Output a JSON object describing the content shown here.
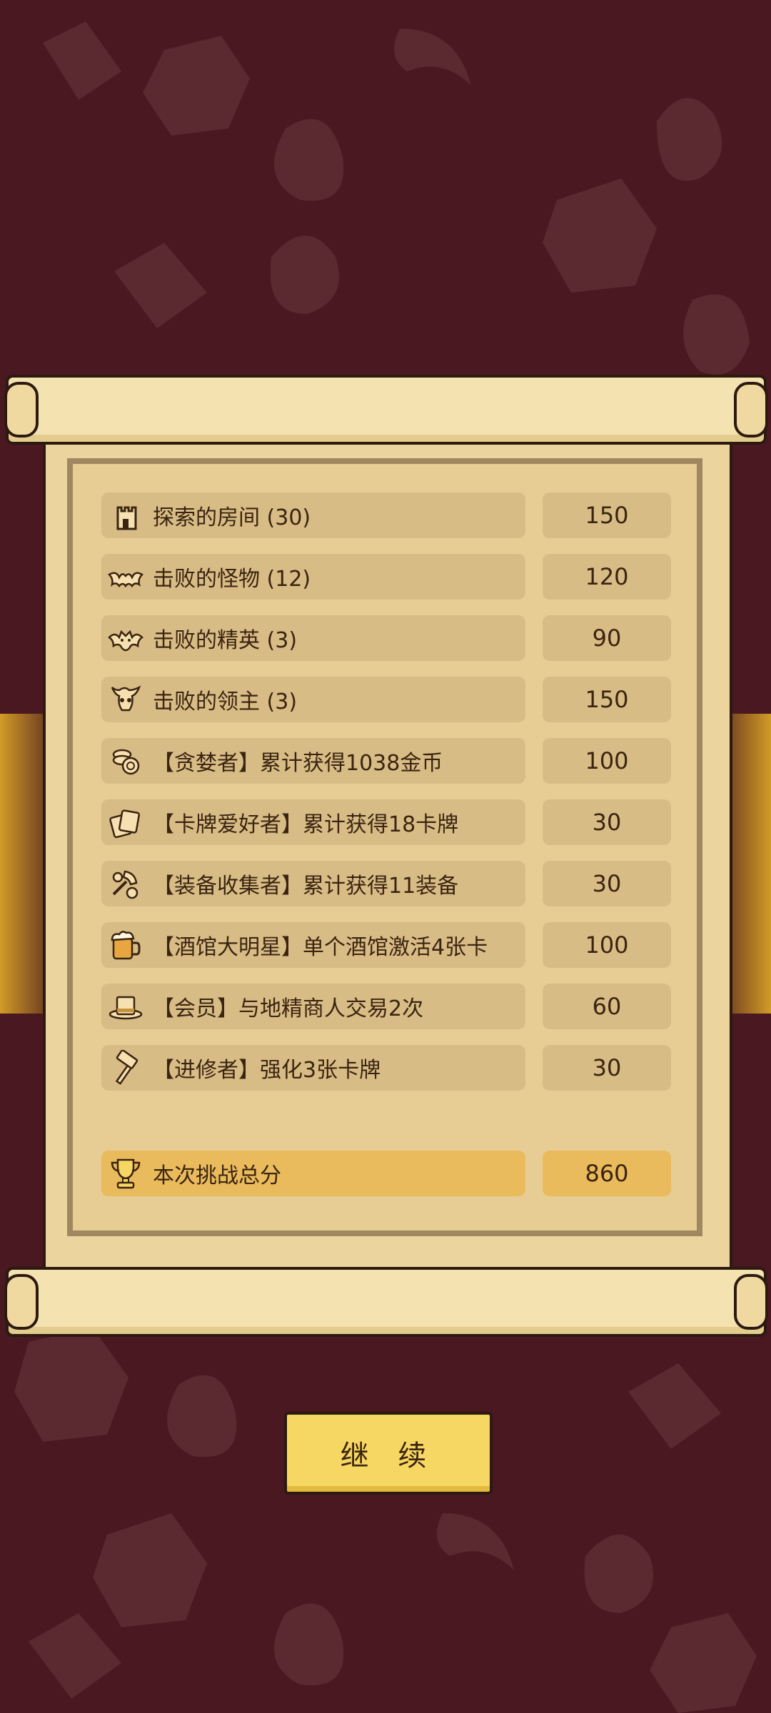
{
  "colors": {
    "background": "#4a1820",
    "paper": "#ecd49e",
    "row": "#d8bc86",
    "total_row": "#e9bb5c",
    "button": "#f7d763",
    "text": "#3b2410"
  },
  "stats": [
    {
      "icon": "tower-icon",
      "label": "探索的房间  (30)",
      "value": "150"
    },
    {
      "icon": "bat-icon",
      "label": "击败的怪物  (12)",
      "value": "120"
    },
    {
      "icon": "winged-demon-icon",
      "label": "击败的精英  (3)",
      "value": "90"
    },
    {
      "icon": "horned-skull-icon",
      "label": "击败的领主  (3)",
      "value": "150"
    },
    {
      "icon": "coins-icon",
      "label": "【贪婪者】累计获得1038金币",
      "value": "100"
    },
    {
      "icon": "cards-icon",
      "label": "【卡牌爱好者】累计获得18卡牌",
      "value": "30"
    },
    {
      "icon": "equipment-icon",
      "label": "【装备收集者】累计获得11装备",
      "value": "30"
    },
    {
      "icon": "beer-mug-icon",
      "label": "【酒馆大明星】单个酒馆激活4张卡",
      "value": "100"
    },
    {
      "icon": "top-hat-icon",
      "label": "【会员】与地精商人交易2次",
      "value": "60"
    },
    {
      "icon": "hammer-icon",
      "label": "【进修者】强化3张卡牌",
      "value": "30"
    }
  ],
  "total": {
    "icon": "trophy-icon",
    "label": "本次挑战总分",
    "value": "860"
  },
  "continue_label": "继 续"
}
